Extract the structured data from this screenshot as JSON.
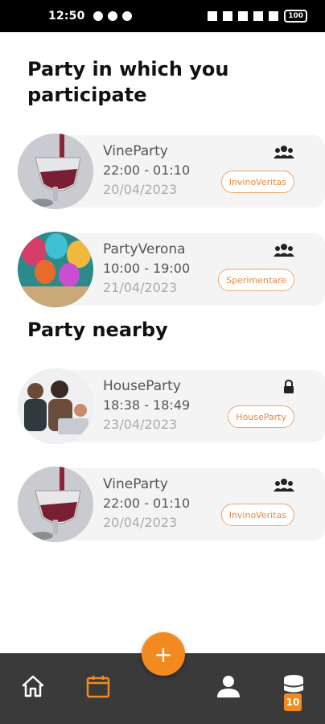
{
  "status": {
    "time": "12:50",
    "battery": "100"
  },
  "sections": {
    "participating_title": "Party in which you participate",
    "nearby_title": "Party nearby"
  },
  "participating": [
    {
      "name": "VineParty",
      "time": "22:00 - 01:10",
      "date": "20/04/2023",
      "tag": "InvinoVeritas",
      "icon": "group-icon"
    },
    {
      "name": "PartyVerona",
      "time": "10:00 - 19:00",
      "date": "21/04/2023",
      "tag": "Sperimentare",
      "icon": "group-icon"
    }
  ],
  "nearby": [
    {
      "name": "HouseParty",
      "time": "18:38 - 18:49",
      "date": "23/04/2023",
      "tag": "HouseParty",
      "icon": "lock-icon"
    },
    {
      "name": "VineParty",
      "time": "22:00 - 01:10",
      "date": "20/04/2023",
      "tag": "InvinoVeritas",
      "icon": "group-icon"
    }
  ],
  "nav": {
    "fab_label": "+",
    "coins_badge": "10",
    "accent": "#f28a1f",
    "bar_color": "#3a3a3a"
  }
}
